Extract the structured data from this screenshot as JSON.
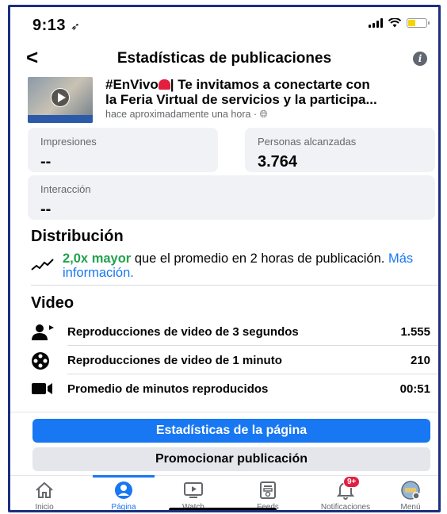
{
  "status_bar": {
    "time": "9:13"
  },
  "header": {
    "title": "Estadísticas de publicaciones"
  },
  "post": {
    "text_line1_prefix": "#EnVivo",
    "text_line1_suffix": "| Te invitamos a conectarte con",
    "text_line2": "la Feria Virtual de servicios y la participa...",
    "meta": "hace aproximadamente una hora · "
  },
  "metrics": {
    "impresiones": {
      "label": "Impresiones",
      "value": "--"
    },
    "alcance": {
      "label": "Personas alcanzadas",
      "value": "3.764"
    },
    "interaccion": {
      "label": "Interacción",
      "value": "--"
    }
  },
  "distribution": {
    "heading": "Distribución",
    "highlight": "2,0x mayor",
    "text": " que el promedio en 2 horas de publicación. ",
    "link": "Más información."
  },
  "video": {
    "heading": "Video",
    "rows": [
      {
        "label": "Reproducciones de video de 3 segundos",
        "value": "1.555"
      },
      {
        "label": "Reproducciones de video de 1 minuto",
        "value": "210"
      },
      {
        "label": "Promedio de minutos reproducidos",
        "value": "00:51"
      }
    ]
  },
  "buttons": {
    "page_stats": "Estadísticas de la página",
    "promote": "Promocionar publicación"
  },
  "tabs": [
    {
      "label": "Inicio",
      "icon": "home-icon"
    },
    {
      "label": "Página",
      "icon": "page-icon"
    },
    {
      "label": "Watch",
      "icon": "watch-icon"
    },
    {
      "label": "Feeds",
      "icon": "feeds-icon"
    },
    {
      "label": "Notificaciones",
      "icon": "bell-icon",
      "badge": "9+"
    },
    {
      "label": "Menú",
      "icon": "menu-icon"
    }
  ],
  "colors": {
    "accent": "#1877f2",
    "positive": "#20a14d",
    "badge": "#e41e3f"
  }
}
